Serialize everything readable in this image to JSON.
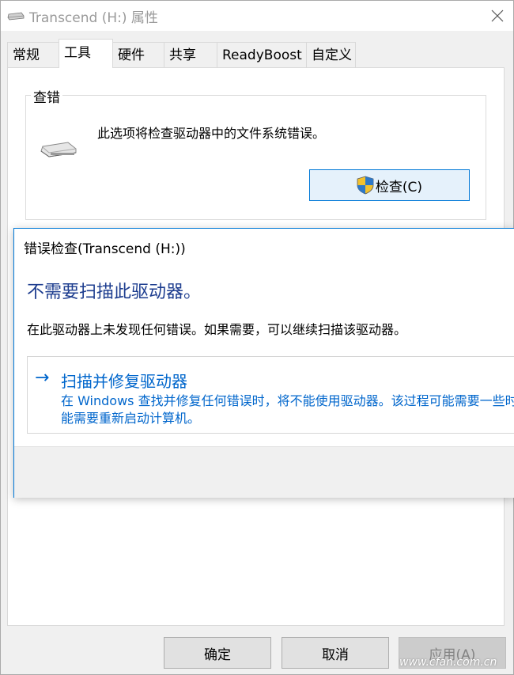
{
  "window": {
    "title": "Transcend (H:) 属性"
  },
  "tabs": [
    "常规",
    "工具",
    "硬件",
    "共享",
    "ReadyBoost",
    "自定义"
  ],
  "active_tab": "工具",
  "error_check_group": {
    "title": "查错",
    "description": "此选项将检查驱动器中的文件系统错误。",
    "check_button_label": "检查(C)"
  },
  "dialog": {
    "title": "错误检查(Transcend (H:))",
    "heading": "不需要扫描此驱动器。",
    "message": "在此驱动器上未发现任何错误。如果需要，可以继续扫描该驱动器。",
    "action_arrow": "→",
    "action_title": "扫描并修复驱动器",
    "action_description": "在 Windows 查找并修复任何错误时，将不能使用驱动器。该过程可能需要一些时间，可能需要重新启动计算机。",
    "action_description_line2": "能需要重新启动计算机。"
  },
  "buttons": {
    "ok": "确定",
    "cancel": "取消",
    "apply": "应用(A)"
  },
  "watermark": "www.cfan.com.cn",
  "colors": {
    "accent": "#0078d7",
    "heading": "#1d3d8f",
    "link": "#0066cc"
  }
}
